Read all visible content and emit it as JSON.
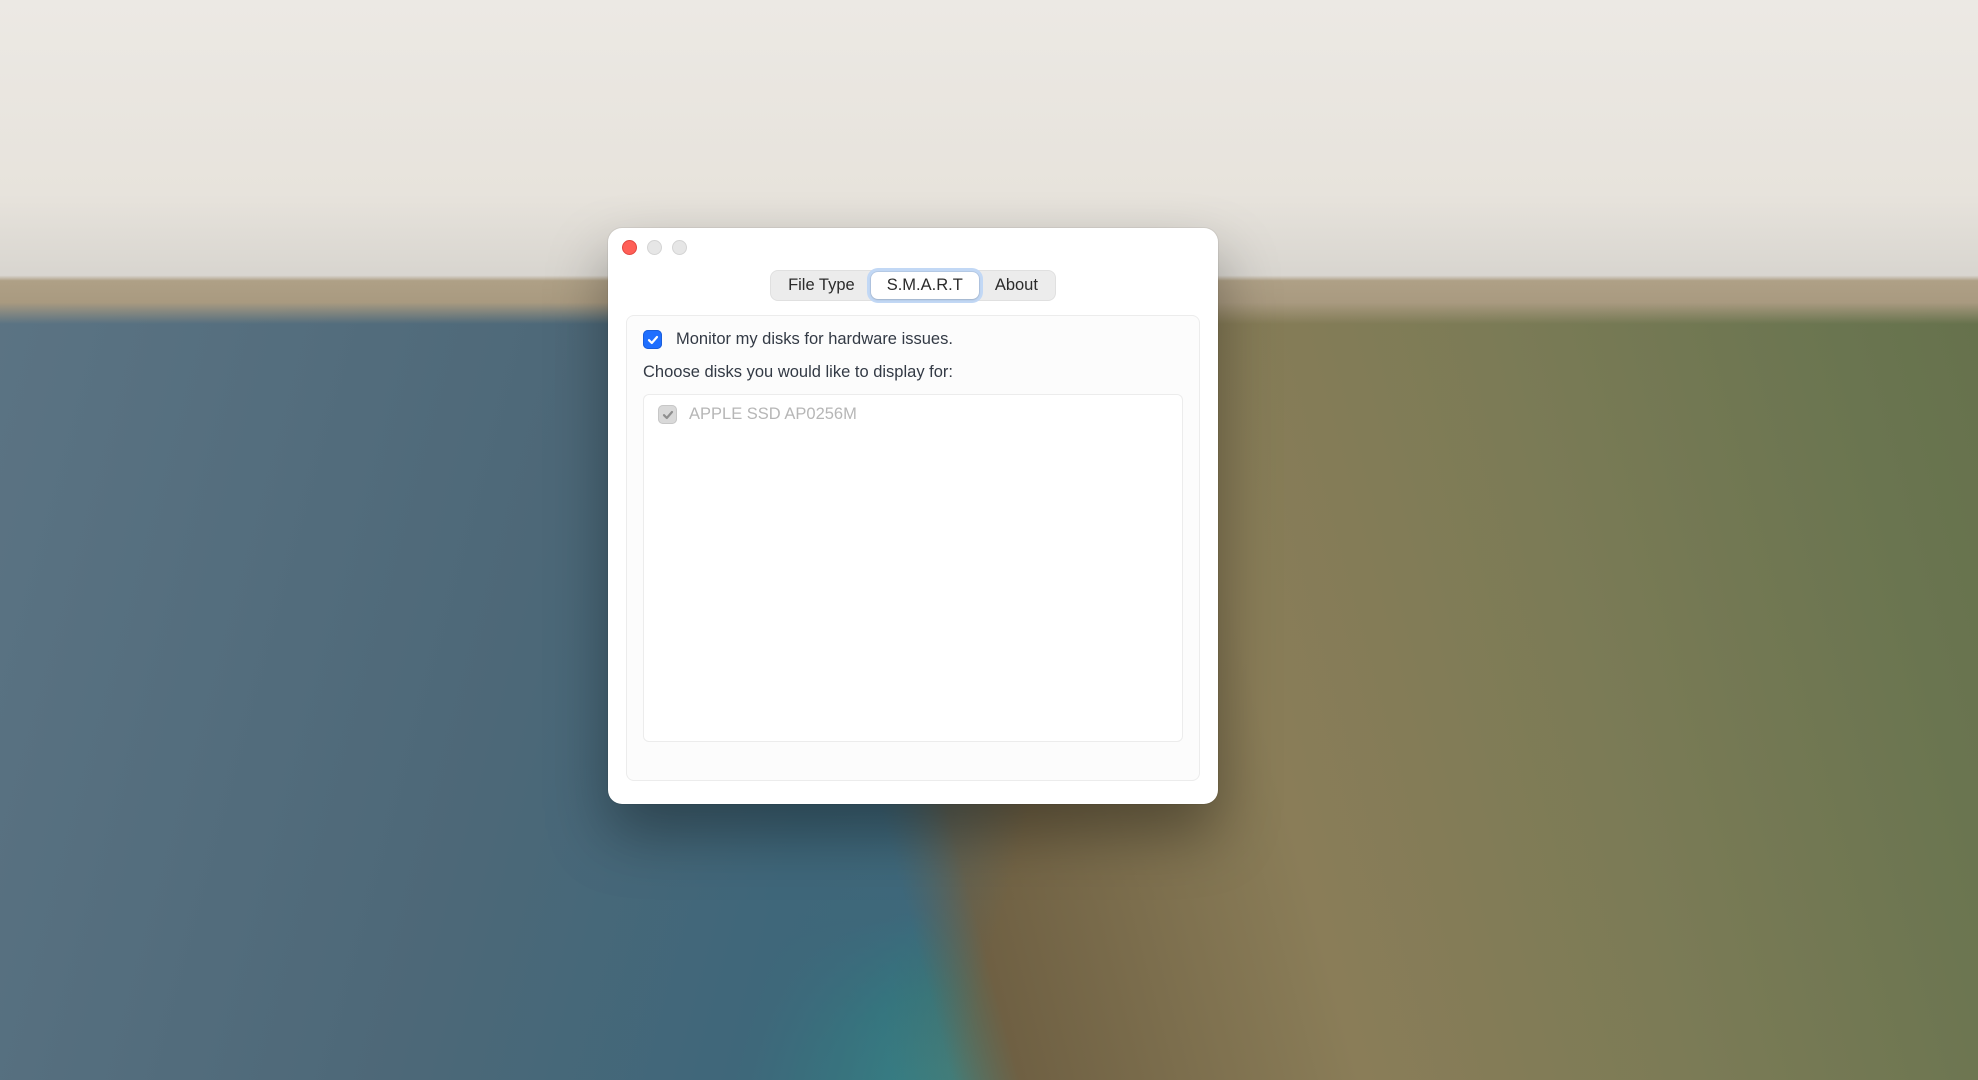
{
  "tabs": {
    "items": [
      {
        "label": "File Type",
        "active": false
      },
      {
        "label": "S.M.A.R.T",
        "active": true
      },
      {
        "label": "About",
        "active": false
      }
    ]
  },
  "smart_panel": {
    "monitor_checkbox": {
      "checked": true
    },
    "monitor_label": "Monitor my disks for hardware issues.",
    "choose_label": "Choose disks you would like to display for:",
    "disks": [
      {
        "name": "APPLE SSD AP0256M",
        "checked": true,
        "enabled": false
      }
    ]
  }
}
